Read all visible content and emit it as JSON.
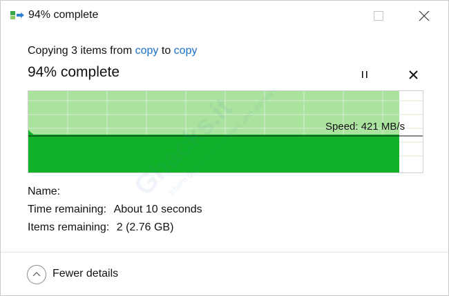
{
  "window": {
    "title": "94% complete",
    "icon": "copy-transfer-icon"
  },
  "titlebar_buttons": [
    "minimize-icon",
    "maximize-icon",
    "close-icon"
  ],
  "copy_info": {
    "prefix": "Copying 3 items from",
    "source": "copy",
    "connector": "to",
    "destination": "copy"
  },
  "progress": {
    "headline": "94% complete",
    "percent": 94,
    "pause_icon": "pause-icon",
    "cancel_icon": "close-icon"
  },
  "speed": {
    "label": "Speed: 421 MB/s"
  },
  "details": {
    "name_label": "Name:",
    "name_value": "",
    "time_label": "Time remaining:",
    "time_value": "About 10 seconds",
    "items_label": "Items remaining:",
    "items_value": "2 (2.76 GB)"
  },
  "footer": {
    "toggle_label": "Fewer details",
    "toggle_icon": "chevron-up-icon"
  },
  "watermark": {
    "brand": "Ghacks.it",
    "tagline": "where geeks and hardware and software"
  },
  "colors": {
    "accent_link": "#1a6fc4",
    "graph_fill_light": "#a9e39d",
    "graph_fill_dark": "#10b229",
    "graph_grid": "#d8ecd2"
  }
}
